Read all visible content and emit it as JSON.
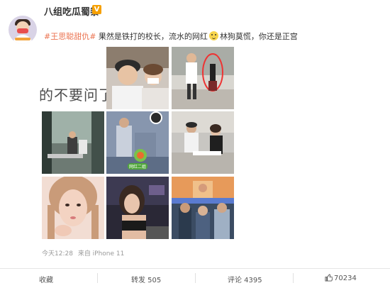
{
  "post": {
    "username": "八组吃瓜蜀黍",
    "verified_badge": "V",
    "hashtag": "#王思聪甜仇#",
    "text_before_emoji": " 果然是铁打的校长，流水的网红",
    "text_after_emoji": "林狗莫慌，你还是正宫",
    "overlay_caption": "的不要问了 祢",
    "timestamp": "今天12:28",
    "source": "来自 iPhone 11"
  },
  "actions": {
    "favorite": "收藏",
    "repost": "转发 505",
    "comment": "评论 4395",
    "like_count": "70234"
  },
  "colors": {
    "hashtag": "#eb7350",
    "verified": "#f6a000"
  },
  "photo_overlays": {
    "sticker_text": "网红二姐"
  }
}
